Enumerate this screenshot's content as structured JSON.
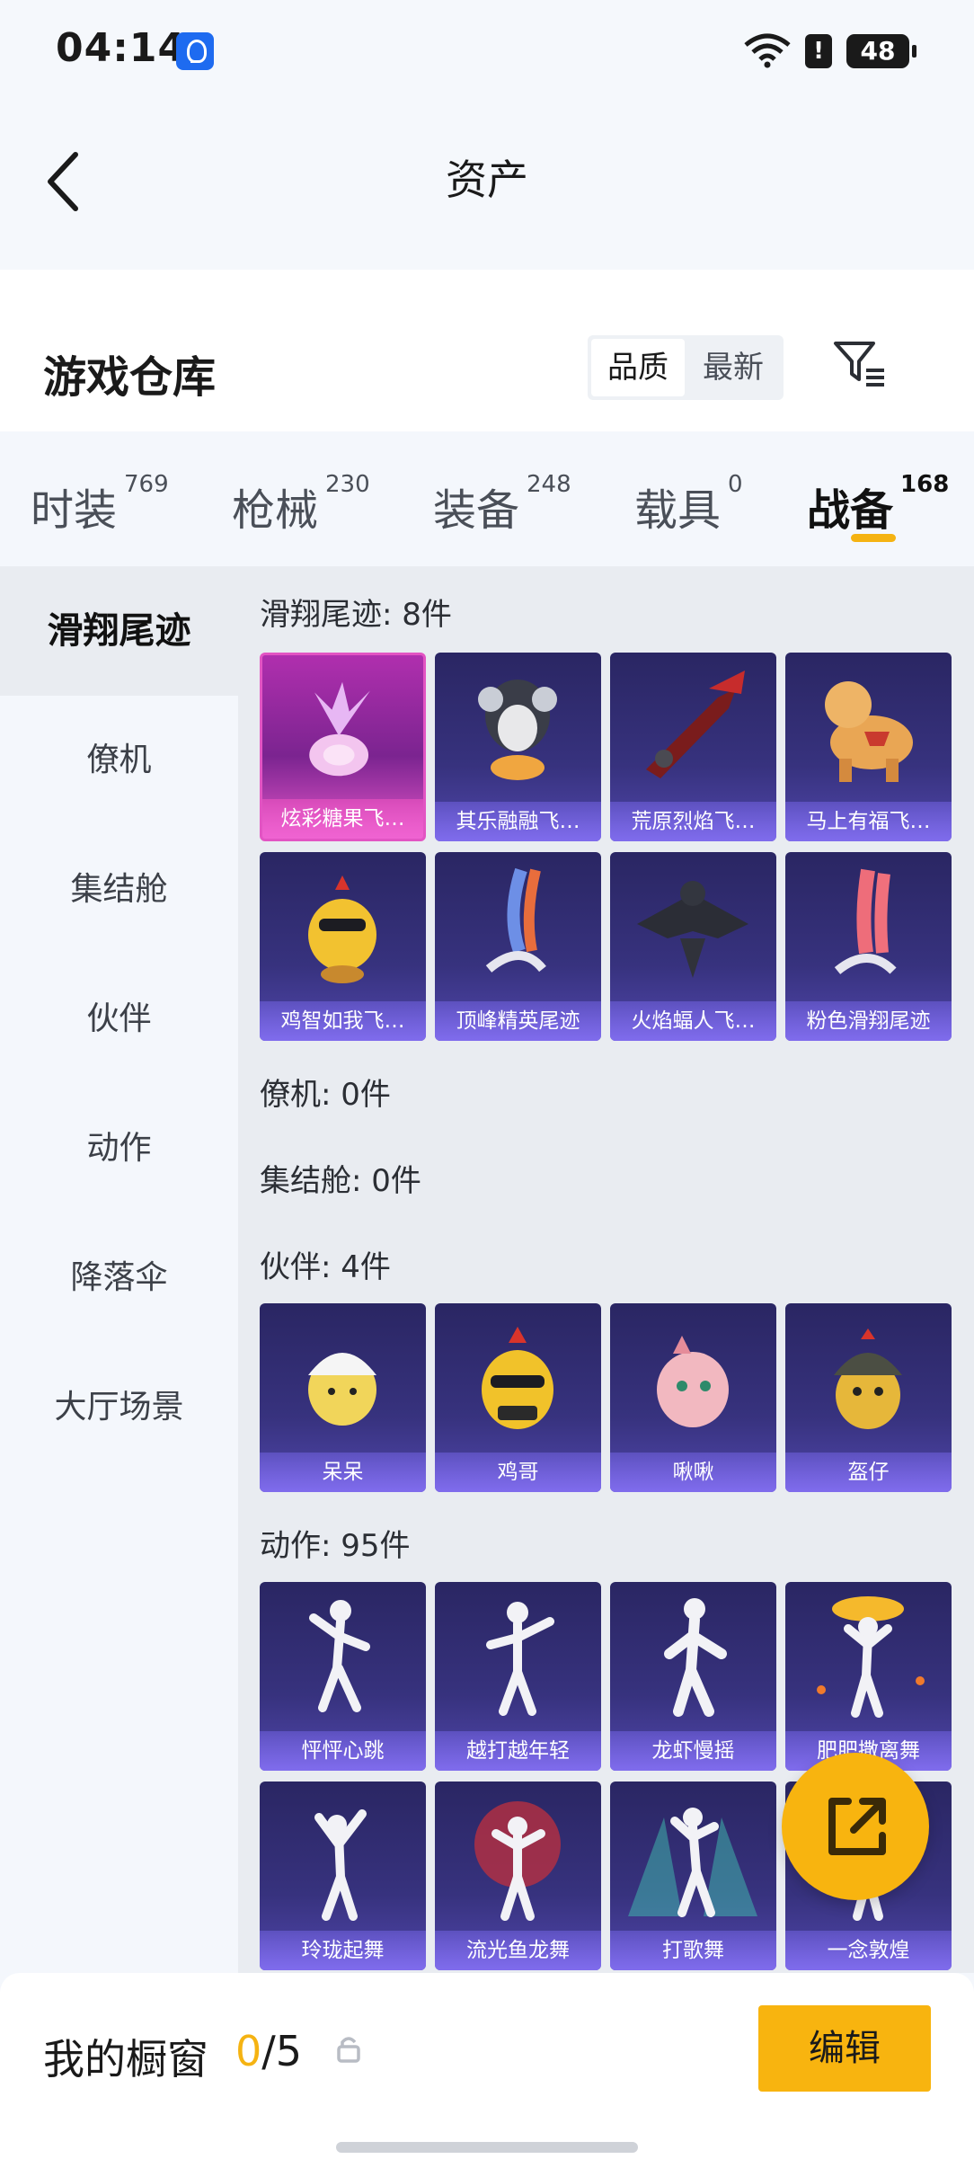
{
  "status_bar": {
    "time": "04:14",
    "battery": "48",
    "icons": [
      "lightbulb-notification-icon",
      "wifi-icon",
      "alert-icon",
      "battery-icon"
    ]
  },
  "header": {
    "title": "资产",
    "back_icon": "chevron-left-icon"
  },
  "warehouse": {
    "title": "游戏仓库",
    "sort_options": [
      "品质",
      "最新"
    ],
    "selected_sort": "品质",
    "filter_icon": "filter-icon"
  },
  "tabs": [
    {
      "label": "时装",
      "count": "769"
    },
    {
      "label": "枪械",
      "count": "230"
    },
    {
      "label": "装备",
      "count": "248"
    },
    {
      "label": "载具",
      "count": "0"
    },
    {
      "label": "战备",
      "count": "168",
      "active": true
    }
  ],
  "sidebar": [
    "滑翔尾迹",
    "僚机",
    "集结舱",
    "伙伴",
    "动作",
    "降落伞",
    "大厅场景"
  ],
  "sections": {
    "glide": {
      "title": "滑翔尾迹: 8件",
      "items": [
        "炫彩糖果飞…",
        "其乐融融飞…",
        "荒原烈焰飞…",
        "马上有福飞…",
        "鸡智如我飞…",
        "顶峰精英尾迹",
        "火焰蝠人飞…",
        "粉色滑翔尾迹"
      ]
    },
    "wingman": {
      "title": "僚机: 0件"
    },
    "pod": {
      "title": "集结舱: 0件"
    },
    "partner": {
      "title": "伙伴: 4件",
      "items": [
        "呆呆",
        "鸡哥",
        "啾啾",
        "盔仔"
      ]
    },
    "emote": {
      "title": "动作: 95件",
      "items": [
        "怦怦心跳",
        "越打越年轻",
        "龙虾慢摇",
        "肥肥撒离舞",
        "玲珑起舞",
        "流光鱼龙舞",
        "打歌舞",
        "一念敦煌"
      ]
    }
  },
  "fab_icon": "share-icon",
  "bottom": {
    "label": "我的橱窗",
    "current": "0",
    "total": "/5",
    "lock_icon": "lock-icon",
    "edit_label": "编辑"
  },
  "colors": {
    "accent": "#f8b40f",
    "card": "#37327e",
    "highlight": "#e254c3"
  }
}
